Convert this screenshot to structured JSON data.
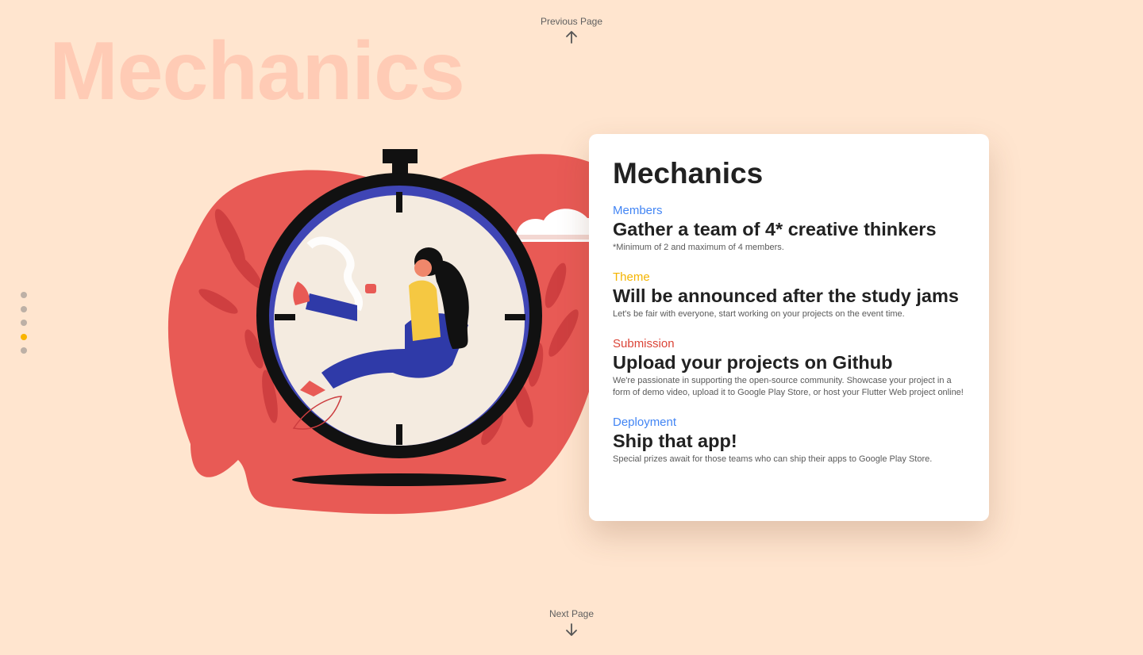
{
  "background_title": "Mechanics",
  "nav": {
    "previous_label": "Previous Page",
    "next_label": "Next Page"
  },
  "pager": {
    "count": 5,
    "active_index": 3,
    "dot_color": "#bdb0a6",
    "active_color": "#f9b400"
  },
  "card": {
    "title": "Mechanics",
    "sections": [
      {
        "label": "Members",
        "label_color": "#4285f4",
        "heading": "Gather a team of 4* creative thinkers",
        "description": "*Minimum of 2 and maximum of 4 members."
      },
      {
        "label": "Theme",
        "label_color": "#f4b400",
        "heading": "Will be announced after the study jams",
        "description": "Let's be fair with everyone, start working on your projects on the event time."
      },
      {
        "label": "Submission",
        "label_color": "#db4437",
        "heading": "Upload your projects on Github",
        "description": "We're passionate in supporting the open-source community. Showcase your project in a form of demo video, upload it to Google Play Store, or host your Flutter Web project online!"
      },
      {
        "label": "Deployment",
        "label_color": "#4285f4",
        "heading": "Ship that app!",
        "description": "Special prizes await for those teams who can ship their apps to Google Play Store."
      }
    ]
  },
  "colors": {
    "page_background": "#ffe5cf",
    "background_title": "#ffcbb5",
    "blob": "#e85a55",
    "clock_ring": "#3f45b5"
  },
  "illustration": {
    "icon": "stopwatch-woman-illustration"
  }
}
